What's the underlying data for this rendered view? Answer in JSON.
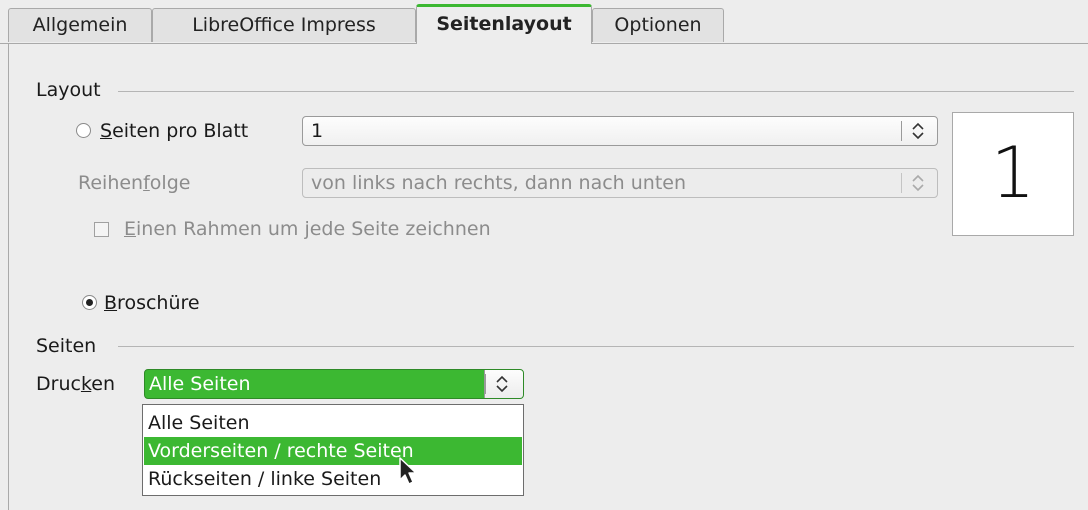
{
  "tabs": [
    {
      "label": "Allgemein"
    },
    {
      "label": "LibreOffice Impress"
    },
    {
      "label": "Seitenlayout"
    },
    {
      "label": "Optionen"
    }
  ],
  "active_tab": "Seitenlayout",
  "layout": {
    "heading": "Layout",
    "pages_per_sheet": {
      "label_accel": "S",
      "label_rest": "eiten pro Blatt",
      "value": "1",
      "selected": false
    },
    "order": {
      "label_pre": "Reihen",
      "label_accel": "f",
      "label_post": "olge",
      "value": "von links nach rechts, dann nach unten",
      "disabled": true
    },
    "border": {
      "label_accel": "E",
      "label_rest": "inen Rahmen um jede Seite zeichnen",
      "checked": false,
      "disabled": true
    },
    "preview_number": "1",
    "brochure": {
      "label_accel": "B",
      "label_rest": "roschüre",
      "selected": true
    }
  },
  "pages": {
    "heading": "Seiten",
    "print_label_pre": "Druc",
    "print_label_accel": "k",
    "print_label_post": "en",
    "print_value": "Alle Seiten",
    "options": [
      {
        "label": "Alle Seiten"
      },
      {
        "label": "Vorderseiten / rechte Seiten"
      },
      {
        "label": "Rückseiten / linke Seiten"
      }
    ],
    "highlighted_option": "Vorderseiten / rechte Seiten"
  },
  "colors": {
    "accent": "#3cb832",
    "background": "#ededed"
  }
}
